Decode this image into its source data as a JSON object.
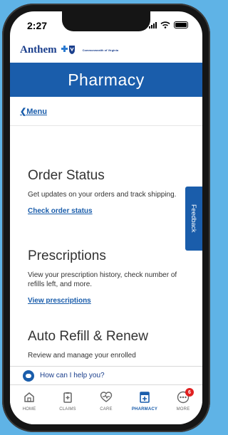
{
  "status_bar": {
    "time": "2:27"
  },
  "brand": {
    "name": "Anthem",
    "sub_label": "Commonwealth of Virginia"
  },
  "header": {
    "title": "Pharmacy"
  },
  "nav": {
    "back_label": "Menu"
  },
  "sections": [
    {
      "title": "Order Status",
      "description": "Get updates on your orders and track shipping.",
      "link": "Check order status"
    },
    {
      "title": "Prescriptions",
      "description": "View your prescription history, check number of refills left, and more.",
      "link": "View prescriptions"
    },
    {
      "title": "Auto Refill & Renew",
      "description": "Review and manage your enrolled"
    }
  ],
  "feedback": {
    "label": "Feedback"
  },
  "help": {
    "text": "How can I help you?"
  },
  "tabs": [
    {
      "label": "HOME",
      "icon": "home-icon"
    },
    {
      "label": "CLAIMS",
      "icon": "clipboard-icon"
    },
    {
      "label": "CARE",
      "icon": "heart-pulse-icon"
    },
    {
      "label": "PHARMACY",
      "icon": "pharmacy-icon",
      "active": true
    },
    {
      "label": "MORE",
      "icon": "more-icon",
      "badge": "6"
    }
  ],
  "colors": {
    "brand_blue": "#1a5dab",
    "background": "#5fb3e6",
    "badge_red": "#e02020"
  }
}
